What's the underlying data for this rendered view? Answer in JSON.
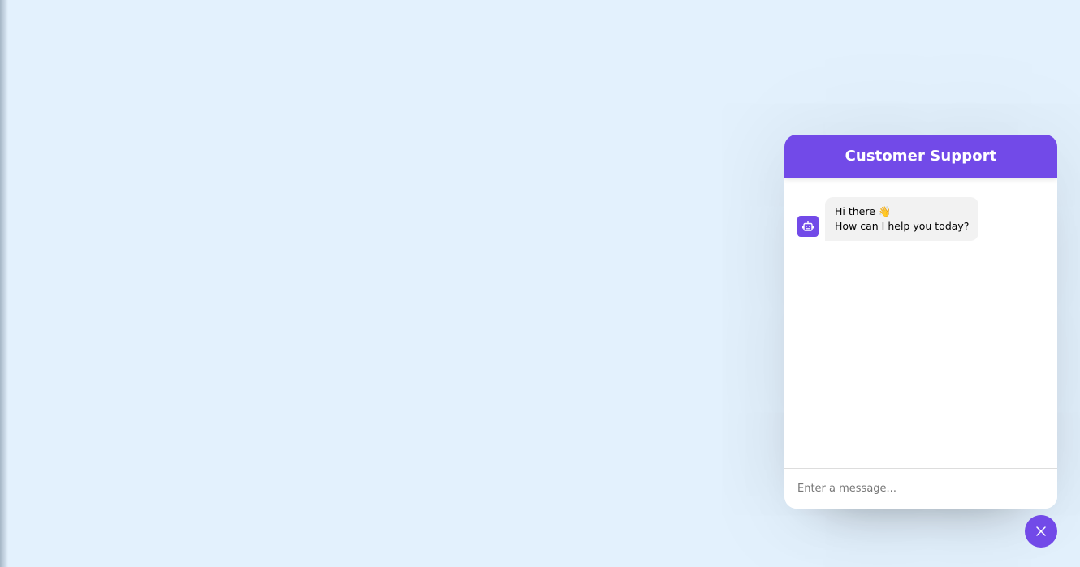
{
  "colors": {
    "page_background": "#e3f1fd",
    "accent": "#724ae8",
    "bubble_background": "#f2f2f2",
    "header_text": "#ffffff"
  },
  "chat": {
    "title": "Customer Support",
    "messages": [
      {
        "sender": "bot",
        "avatar_icon": "smart-toy-icon",
        "text": "Hi there 👋\nHow can I help you today?"
      }
    ],
    "input": {
      "placeholder": "Enter a message...",
      "value": ""
    }
  },
  "toggler": {
    "icon": "close-icon"
  }
}
